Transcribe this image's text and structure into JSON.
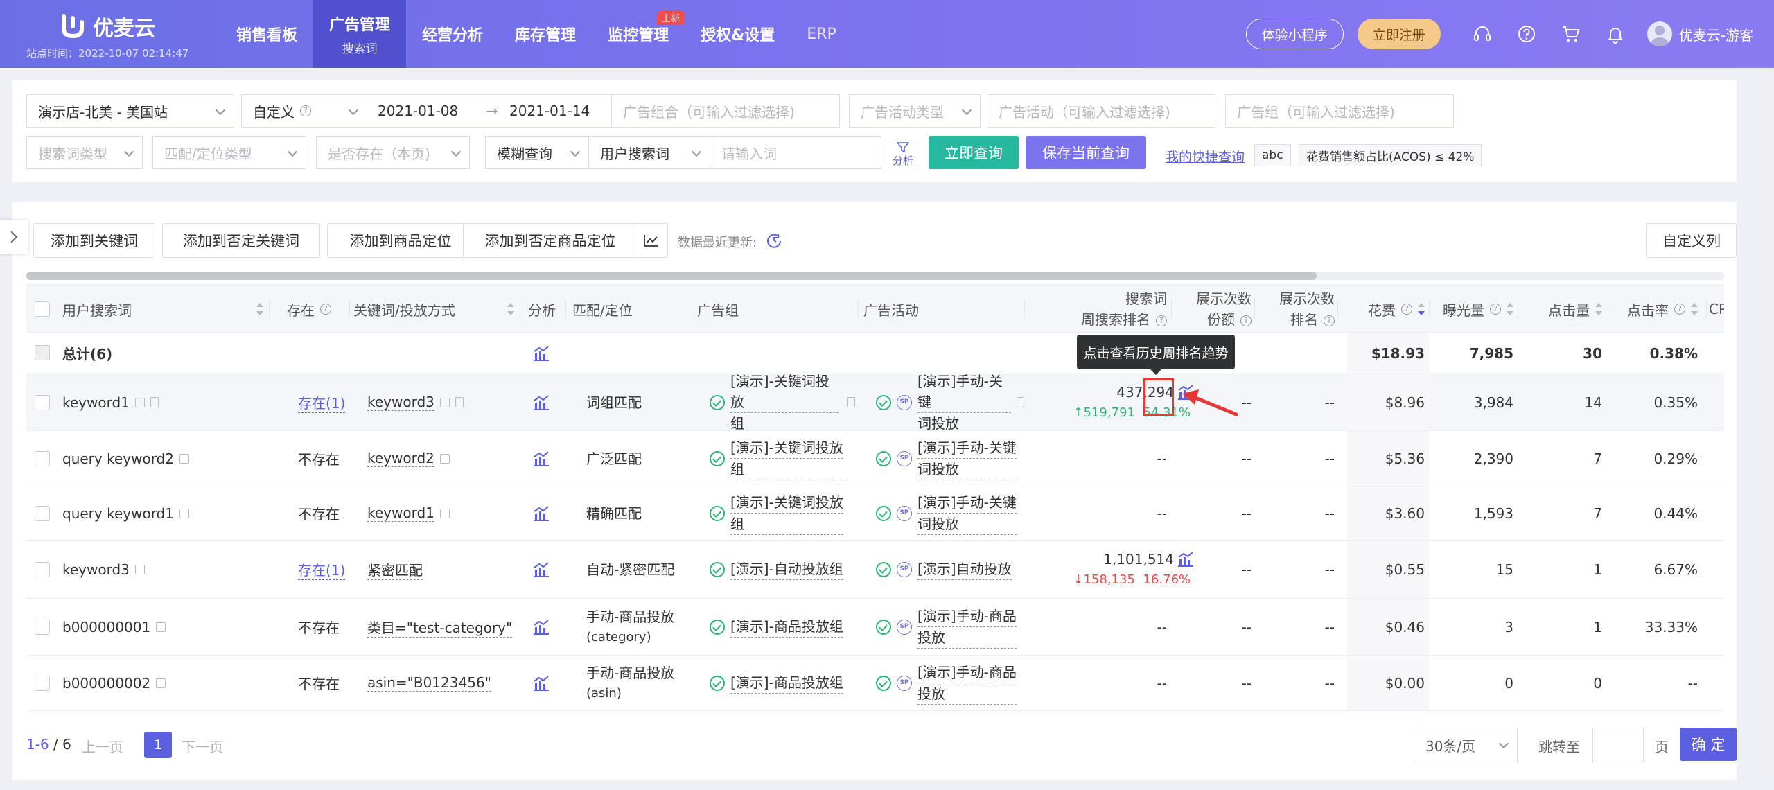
{
  "brand": {
    "name": "优麦云",
    "site_time": "站点时间：2022-10-07 02:14:47"
  },
  "colors": {
    "nav_gradient_start": "#6b6fe6",
    "nav_active": "#5151cf",
    "accent": "#5b5fe0",
    "teal": "#26b9a0",
    "success": "#2bb673",
    "danger": "#ef4444",
    "highlight": "#e53935"
  },
  "nav": {
    "items": [
      {
        "label": "销售看板"
      },
      {
        "label": "广告管理",
        "sub": "搜索词"
      },
      {
        "label": "经营分析"
      },
      {
        "label": "库存管理"
      },
      {
        "label": "监控管理",
        "badge": "上新"
      },
      {
        "label": "授权&设置"
      },
      {
        "label": "ERP"
      }
    ],
    "mini_program": "体验小程序",
    "register": "立即注册",
    "user": "优麦云-游客",
    "icons": [
      "headset-icon",
      "help-icon",
      "cart-icon",
      "bell-icon"
    ]
  },
  "filters": {
    "store": "演示店-北美 - 美国站",
    "date_mode": "自定义",
    "date_start": "2021-01-08",
    "date_arrow": "→",
    "date_end": "2021-01-14",
    "ad_portfolio_ph": "广告组合（可输入过滤选择)",
    "campaign_type_ph": "广告活动类型",
    "campaign_ph": "广告活动（可输入过滤选择)",
    "ad_group_ph": "广告组（可输入过滤选择)",
    "search_term_type_ph": "搜索词类型",
    "match_type_ph": "匹配/定位类型",
    "exists_ph": "是否存在（本页)",
    "fuzzy": "模糊查询",
    "field": "用户搜索词",
    "input_ph": "请输入词",
    "analyze": "分析",
    "query_btn": "立即查询",
    "save_btn": "保存当前查询",
    "quick_link": "我的快捷查询",
    "tag1": "abc",
    "tag2": "花费销售额占比(ACOS) ≤ 42%"
  },
  "toolbar": {
    "add_keyword": "添加到关键词",
    "add_negative_keyword": "添加到否定关键词",
    "add_product_target": "添加到商品定位",
    "add_negative_product_target": "添加到否定商品定位",
    "update_note": "数据最近更新:",
    "custom_columns": "自定义列"
  },
  "table": {
    "headers": {
      "search_term": "用户搜索词",
      "exists": "存在",
      "keyword": "关键词/投放方式",
      "analyze": "分析",
      "match": "匹配/定位",
      "ad_group": "广告组",
      "campaign": "广告活动",
      "rank_l1": "搜索词",
      "rank_l2": "周搜索排名",
      "share_l1": "展示次数",
      "share_l2": "份额",
      "impr_rank_l1": "展示次数",
      "impr_rank_l2": "排名",
      "spend": "花费",
      "impressions": "曝光量",
      "clicks": "点击量",
      "ctr": "点击率",
      "cpc": "CPC"
    },
    "total": {
      "label": "总计(6)",
      "spend": "$18.93",
      "impressions": "7,985",
      "clicks": "30",
      "ctr": "0.38%"
    },
    "rows": [
      {
        "term": "keyword1",
        "exists": "存在(1)",
        "keyword": "keyword3",
        "match": "词组匹配",
        "ad_group_l1": "[演示]-关键词投放",
        "ad_group_l2": "组",
        "campaign_l1": "[演示]手动-关键",
        "campaign_l2": "词投放",
        "rank": "437,294",
        "rank_change": "↑519,791",
        "rank_pct": "54.31%",
        "share": "--",
        "impr_rank": "--",
        "spend": "$8.96",
        "impressions": "3,984",
        "clicks": "14",
        "ctr": "0.35%"
      },
      {
        "term": "query keyword2",
        "exists": "不存在",
        "keyword": "keyword2",
        "match": "广泛匹配",
        "ad_group_l1": "[演示]-关键词投放",
        "ad_group_l2": "组",
        "campaign_l1": "[演示]手动-关键",
        "campaign_l2": "词投放",
        "rank": "--",
        "share": "--",
        "impr_rank": "--",
        "spend": "$5.36",
        "impressions": "2,390",
        "clicks": "7",
        "ctr": "0.29%"
      },
      {
        "term": "query keyword1",
        "exists": "不存在",
        "keyword": "keyword1",
        "match": "精确匹配",
        "ad_group_l1": "[演示]-关键词投放",
        "ad_group_l2": "组",
        "campaign_l1": "[演示]手动-关键",
        "campaign_l2": "词投放",
        "rank": "--",
        "share": "--",
        "impr_rank": "--",
        "spend": "$3.60",
        "impressions": "1,593",
        "clicks": "7",
        "ctr": "0.44%"
      },
      {
        "term": "keyword3",
        "exists": "存在(1)",
        "keyword": "紧密匹配",
        "match": "自动-紧密匹配",
        "ad_group_l1": "[演示]-自动投放组",
        "campaign_l1": "[演示]自动投放",
        "rank": "1,101,514",
        "rank_change": "↓158,135",
        "rank_pct": "16.76%",
        "share": "--",
        "impr_rank": "--",
        "spend": "$0.55",
        "impressions": "15",
        "clicks": "1",
        "ctr": "6.67%"
      },
      {
        "term": "b000000001",
        "exists": "不存在",
        "keyword": "类目=\"test-category\"",
        "match": "手动-商品投放",
        "match_l2": "(category)",
        "ad_group_l1": "[演示]-商品投放组",
        "campaign_l1": "[演示]手动-商品",
        "campaign_l2": "投放",
        "rank": "--",
        "share": "--",
        "impr_rank": "--",
        "spend": "$0.46",
        "impressions": "3",
        "clicks": "1",
        "ctr": "33.33%"
      },
      {
        "term": "b000000002",
        "exists": "不存在",
        "keyword": "asin=\"B0123456\"",
        "match": "手动-商品投放",
        "match_l2": "(asin)",
        "ad_group_l1": "[演示]-商品投放组",
        "campaign_l1": "[演示]手动-商品",
        "campaign_l2": "投放",
        "rank": "--",
        "share": "--",
        "impr_rank": "--",
        "spend": "$0.00",
        "impressions": "0",
        "clicks": "0",
        "ctr": "--"
      }
    ]
  },
  "tooltip": "点击查看历史周排名趋势",
  "pager": {
    "range": "1-6",
    "total": " / 6",
    "prev": "上一页",
    "page": "1",
    "next": "下一页",
    "size": "30条/页",
    "jump": "跳转至",
    "page_unit": "页",
    "ok": "确 定"
  }
}
